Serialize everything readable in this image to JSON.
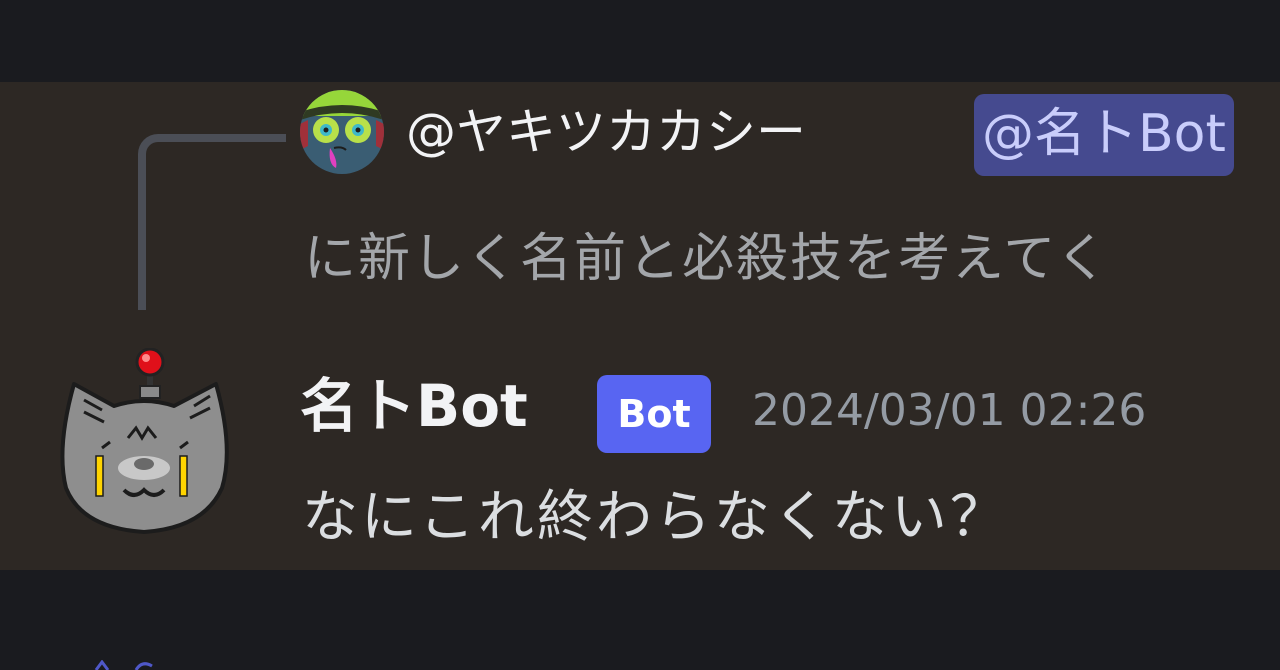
{
  "reply": {
    "author": "@ヤキツカカシー",
    "mention": "@名トBot",
    "preview": "に新しく名前と必殺技を考えてく"
  },
  "message": {
    "username": "名トBot",
    "tag": "Bot",
    "timestamp": "2024/03/01 02:26",
    "content": "なにこれ終わらなくない？"
  },
  "colors": {
    "background": "#1a1b1f",
    "message_highlight": "#2d2824",
    "mention_bg": "#454a8f",
    "bot_tag": "#5865f2",
    "timestamp": "#949ba4"
  },
  "icons": {
    "reply_avatar": "alien-face-avatar",
    "bot_avatar": "robot-cat-avatar"
  }
}
